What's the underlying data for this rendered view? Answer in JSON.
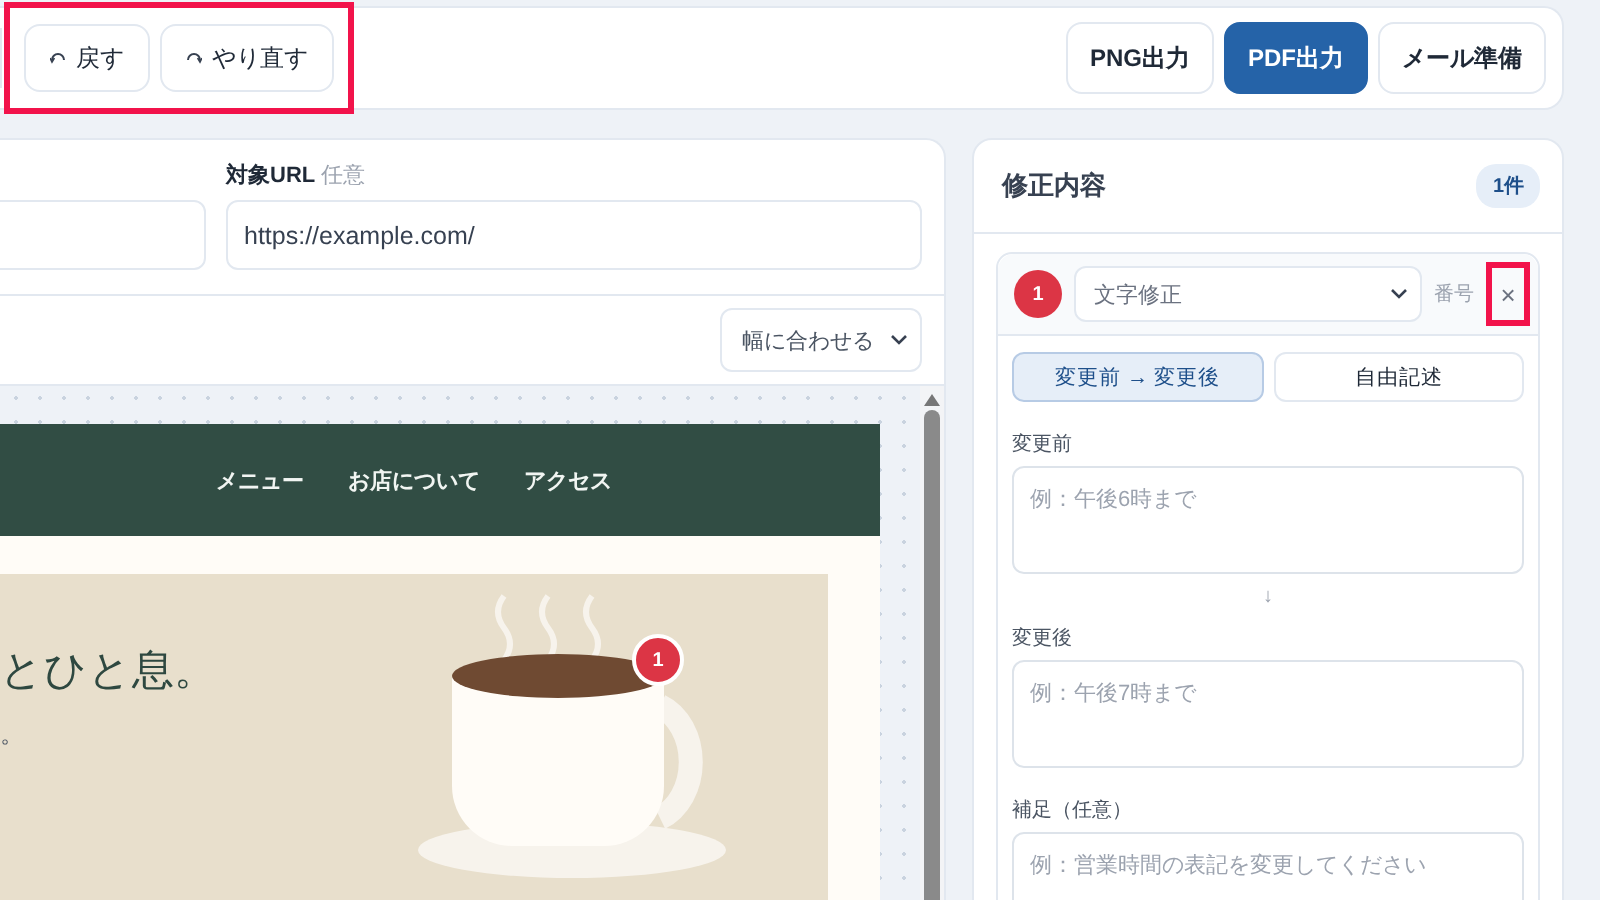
{
  "toolbar": {
    "history_highlighted": true,
    "history_buttons": [
      {
        "label": "戻す",
        "kind": "undo"
      },
      {
        "label": "やり直す",
        "kind": "redo"
      }
    ],
    "export_buttons": [
      {
        "label": "PNG出力",
        "kind": "default"
      },
      {
        "label": "PDF出力",
        "kind": "primary"
      },
      {
        "label": "メール準備",
        "kind": "default"
      }
    ]
  },
  "form": {
    "url_label": "対象URL",
    "url_optional": "任意",
    "url_value": "https://example.com/"
  },
  "zoom_select": "幅に合わせる",
  "preview": {
    "nav_links": [
      "メニュー",
      "お店について",
      "アクセス"
    ],
    "headline": "とひと息。",
    "subtext": "。",
    "marker": "1"
  },
  "panel": {
    "title": "修正内容",
    "count": "1件",
    "items": [
      {
        "number": "1",
        "type": "文字修正",
        "number_label": "番号",
        "close": "×",
        "close_highlighted": true,
        "arrow": "↓",
        "modes": [
          {
            "label": "変更前 → 変更後",
            "selected": true
          },
          {
            "label": "自由記述",
            "selected": false
          }
        ],
        "fields": [
          {
            "label": "変更前",
            "placeholder": "例：午後6時まで"
          },
          {
            "label": "変更後",
            "placeholder": "例：午後7時まで"
          },
          {
            "label": "補足（任意）",
            "placeholder": "例：営業時間の表記を変更してください"
          }
        ]
      }
    ]
  }
}
